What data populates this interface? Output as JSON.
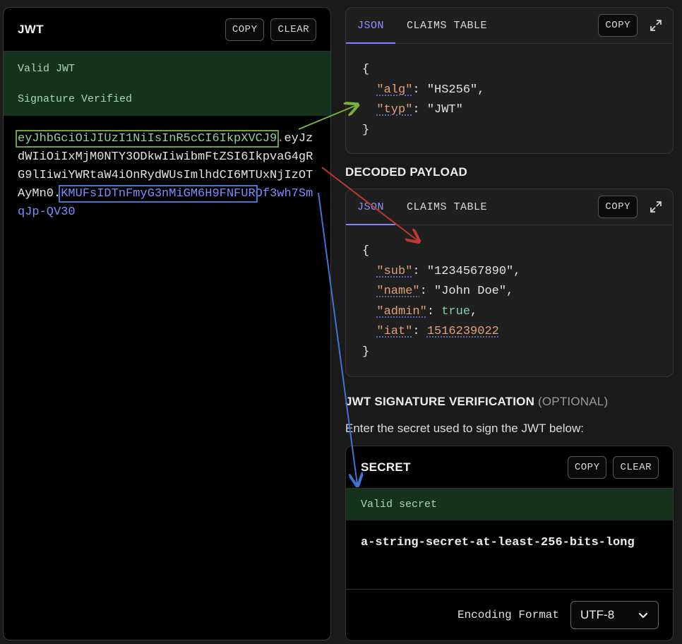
{
  "jwt": {
    "title": "JWT",
    "copy_label": "COPY",
    "clear_label": "CLEAR",
    "status_valid": "Valid JWT",
    "status_signature": "Signature Verified",
    "token_header": "eyJhbGciOiJIUzI1NiIsInR5cCI6IkpXVCJ9",
    "token_dot": ".",
    "token_payload": "eyJzdWIiOiIxMjM0NTY3ODkwIiwibmFtZSI6IkpvaG4gRG9lIiwiYWRtaW4iOnRydWUsImlhdCI6MTUxNjIzOTAyMn0",
    "token_dot2": ".",
    "token_signature": "KMUFsIDTnFmyG3nMiGM6H9FNFUR",
    "token_signature_rest": "Of3wh7SmqJp-QV30"
  },
  "header_card": {
    "tab_json": "JSON",
    "tab_claims": "CLAIMS TABLE",
    "copy_label": "COPY",
    "open_brace": "{",
    "close_brace": "}",
    "alg_key": "\"alg\"",
    "alg_value": "\"HS256\"",
    "typ_key": "\"typ\"",
    "typ_value": "\"JWT\""
  },
  "payload_section": {
    "title": "DECODED PAYLOAD"
  },
  "payload_card": {
    "tab_json": "JSON",
    "tab_claims": "CLAIMS TABLE",
    "copy_label": "COPY",
    "open_brace": "{",
    "close_brace": "}",
    "sub_key": "\"sub\"",
    "sub_value": "\"1234567890\"",
    "name_key": "\"name\"",
    "name_value": "\"John Doe\"",
    "admin_key": "\"admin\"",
    "admin_value": "true",
    "iat_key": "\"iat\"",
    "iat_value": "1516239022"
  },
  "verification": {
    "title": "JWT SIGNATURE VERIFICATION",
    "title_optional": "(OPTIONAL)",
    "help": "Enter the secret used to sign the JWT below:"
  },
  "secret": {
    "title": "SECRET",
    "copy_label": "COPY",
    "clear_label": "CLEAR",
    "status": "Valid secret",
    "value": "a-string-secret-at-least-256-bits-long",
    "encoding_label": "Encoding Format",
    "encoding_value": "UTF-8"
  },
  "colors": {
    "header_highlight": "#6aa33a",
    "payload_arrow": "#c0392b",
    "signature_highlight": "#3f73d4",
    "accent": "#7c86ff"
  }
}
